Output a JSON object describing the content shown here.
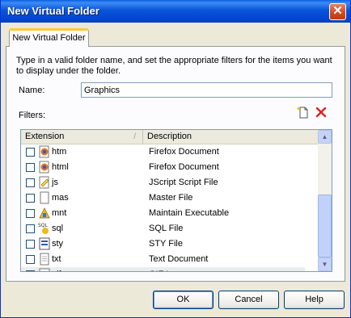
{
  "window": {
    "title": "New Virtual Folder",
    "close_glyph": "✕"
  },
  "tab": {
    "label": "New Virtual Folder"
  },
  "form": {
    "description": "Type in a valid folder name, and set the appropriate filters for the items you want to display under the folder.",
    "name_label": "Name:",
    "name_value": "Graphics",
    "filters_label": "Filters:"
  },
  "list": {
    "columns": {
      "extension": "Extension",
      "description": "Description",
      "sort_glyph": "/"
    },
    "rows": [
      {
        "ext": "htm",
        "desc": "Firefox Document",
        "checked": false,
        "icon": "firefox-document-icon"
      },
      {
        "ext": "html",
        "desc": "Firefox Document",
        "checked": false,
        "icon": "firefox-document-icon"
      },
      {
        "ext": "js",
        "desc": "JScript Script File",
        "checked": false,
        "icon": "script-file-icon"
      },
      {
        "ext": "mas",
        "desc": "Master File",
        "checked": false,
        "icon": "generic-file-icon"
      },
      {
        "ext": "mnt",
        "desc": "Maintain Executable",
        "checked": false,
        "icon": "maintain-executable-icon"
      },
      {
        "ext": "sql",
        "desc": "SQL File",
        "checked": false,
        "icon": "sql-file-icon"
      },
      {
        "ext": "sty",
        "desc": "STY File",
        "checked": false,
        "icon": "sty-file-icon"
      },
      {
        "ext": "txt",
        "desc": "Text Document",
        "checked": false,
        "icon": "text-document-icon"
      },
      {
        "ext": "gif",
        "desc": "GIF Image",
        "checked": true,
        "icon": "gif-image-icon"
      }
    ]
  },
  "buttons": {
    "ok": "OK",
    "cancel": "Cancel",
    "help": "Help"
  },
  "colors": {
    "titlebar": "#0a55d8",
    "checkmark": "#21a121",
    "delete": "#e02020"
  }
}
